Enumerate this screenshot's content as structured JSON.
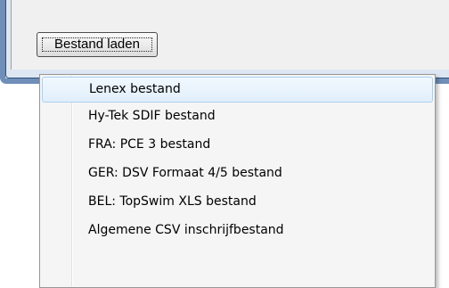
{
  "button": {
    "label": "Bestand laden"
  },
  "menu": {
    "items": [
      {
        "label": "Lenex bestand",
        "highlighted": true
      },
      {
        "label": "Hy-Tek SDIF bestand"
      },
      {
        "label": "FRA: PCE 3 bestand"
      },
      {
        "label": "GER: DSV Formaat 4/5 bestand"
      },
      {
        "label": "BEL: TopSwim XLS bestand"
      },
      {
        "label": "Algemene CSV inschrijfbestand"
      }
    ]
  },
  "colors": {
    "frame": "#6f8fb8",
    "highlight_border": "#a8d0f2",
    "highlight_fill": "#e1effb",
    "menu_background": "#f5f5f5"
  }
}
